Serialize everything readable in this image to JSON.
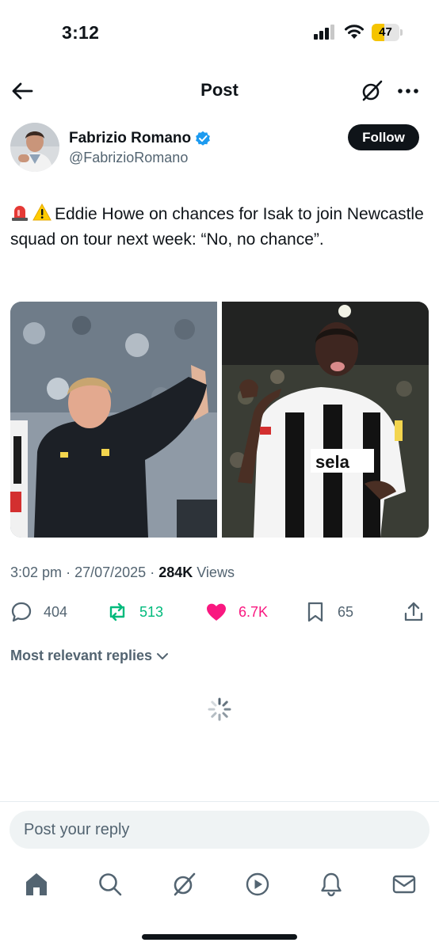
{
  "status_bar": {
    "time": "3:12",
    "battery_level": "47",
    "battery_percent": 47
  },
  "header": {
    "title": "Post",
    "back_icon": "back-arrow-icon",
    "grok_icon": "grok-icon",
    "more_icon": "more-icon"
  },
  "author": {
    "name": "Fabrizio Romano",
    "handle": "@FabrizioRomano",
    "verified": true,
    "follow_label": "Follow"
  },
  "tweet": {
    "emojis": [
      "siren-emoji",
      "warning-emoji"
    ],
    "text": "Eddie Howe on chances for Isak to join Newcastle squad on tour next week: “No, no chance”.",
    "media": [
      "photo-eddie-howe-waving",
      "photo-isak-thumb-point"
    ],
    "time": "3:02 pm",
    "date": "27/07/2025",
    "views_count": "284K",
    "views_label": "Views",
    "separator": "·"
  },
  "actions": {
    "replies": "404",
    "reposts": "513",
    "likes": "6.7K",
    "bookmarks": "65"
  },
  "replies_filter": "Most relevant replies",
  "reply_box": {
    "placeholder": "Post your reply"
  },
  "nav": [
    "home-icon",
    "search-icon",
    "grok-icon",
    "video-icon",
    "notifications-icon",
    "messages-icon"
  ],
  "colors": {
    "text": "#0f1419",
    "secondary": "#536471",
    "verified": "#1d9bf0",
    "repost": "#00ba7c",
    "like": "#f91880",
    "battery": "#f5c400"
  }
}
